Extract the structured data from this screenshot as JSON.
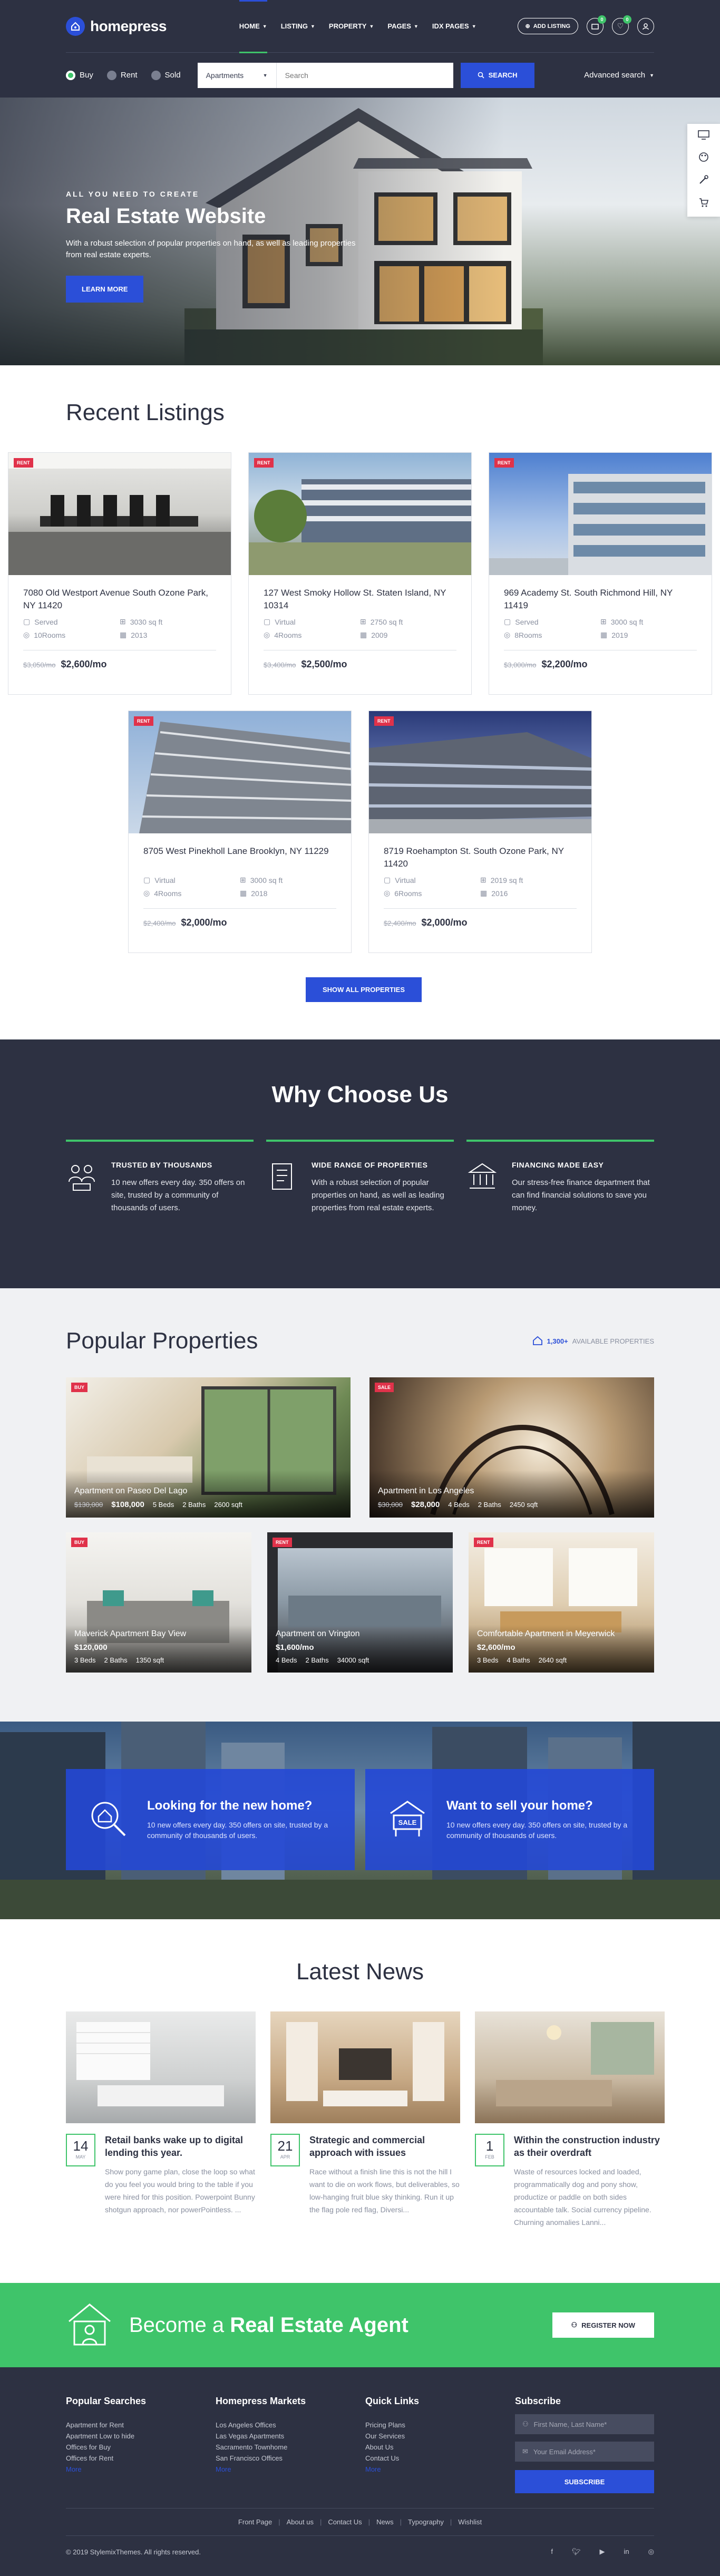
{
  "header": {
    "logo": "homepress",
    "nav": [
      {
        "label": "HOME"
      },
      {
        "label": "LISTING"
      },
      {
        "label": "PROPERTY"
      },
      {
        "label": "PAGES"
      },
      {
        "label": "IDX PAGES"
      }
    ],
    "add_listing": "ADD LISTING",
    "badges": {
      "compare": "0",
      "favorites": "0"
    }
  },
  "search": {
    "radios": [
      "Buy",
      "Rent",
      "Sold"
    ],
    "selected": "Buy",
    "type": "Apartments",
    "placeholder": "Search",
    "button": "SEARCH",
    "advanced": "Advanced search"
  },
  "hero": {
    "kicker": "ALL YOU NEED TO CREATE",
    "title": "Real Estate Website",
    "subtitle": "With a robust selection of popular properties on hand, as well as leading properties from real estate experts.",
    "button": "LEARN MORE"
  },
  "recent": {
    "title": "Recent Listings",
    "items": [
      {
        "tag": "RENT",
        "address": "7080 Old Westport Avenue South Ozone Park, NY 11420",
        "f1": "Served",
        "f2": "3030 sq ft",
        "f3": "10Rooms",
        "f4": "2013",
        "old": "$3,050/mo",
        "price": "$2,600/mo"
      },
      {
        "tag": "RENT",
        "address": "127 West Smoky Hollow St. Staten Island, NY 10314",
        "f1": "Virtual",
        "f2": "2750 sq ft",
        "f3": "4Rooms",
        "f4": "2009",
        "old": "$3,400/mo",
        "price": "$2,500/mo"
      },
      {
        "tag": "RENT",
        "address": "969 Academy St. South Richmond Hill, NY 11419",
        "f1": "Served",
        "f2": "3000 sq ft",
        "f3": "8Rooms",
        "f4": "2019",
        "old": "$3,000/mo",
        "price": "$2,200/mo"
      },
      {
        "tag": "RENT",
        "address": "8705 West Pinekholl Lane Brooklyn, NY 11229",
        "f1": "Virtual",
        "f2": "3000 sq ft",
        "f3": "4Rooms",
        "f4": "2018",
        "old": "$2,400/mo",
        "price": "$2,000/mo"
      },
      {
        "tag": "RENT",
        "address": "8719 Roehampton St. South Ozone Park, NY 11420",
        "f1": "Virtual",
        "f2": "2019 sq ft",
        "f3": "6Rooms",
        "f4": "2016",
        "old": "$2,400/mo",
        "price": "$2,000/mo"
      }
    ],
    "button": "SHOW ALL PROPERTIES"
  },
  "why": {
    "title": "Why Choose Us",
    "cols": [
      {
        "h": "TRUSTED BY THOUSANDS",
        "p": "10 new offers every day. 350 offers on site, trusted by a community of thousands of users."
      },
      {
        "h": "WIDE RANGE OF PROPERTIES",
        "p": "With a robust selection of popular properties on hand, as well as leading properties from real estate experts."
      },
      {
        "h": "FINANCING MADE EASY",
        "p": "Our stress-free finance department that can find financial solutions to save you money."
      }
    ]
  },
  "popular": {
    "title": "Popular Properties",
    "count": "1,300+",
    "count_label": "AVAILABLE PROPERTIES",
    "items": [
      {
        "tag": "BUY",
        "name": "Apartment on Paseo Del Lago",
        "old": "$130,000",
        "price": "$108,000",
        "beds": "5 Beds",
        "baths": "2 Baths",
        "area": "2600 sqft"
      },
      {
        "tag": "SALE",
        "name": "Apartment in Los Angeles",
        "old": "$30,000",
        "price": "$28,000",
        "beds": "4 Beds",
        "baths": "2 Baths",
        "area": "2450 sqft"
      },
      {
        "tag": "BUY",
        "name": "Maverick Apartment Bay View",
        "old": "",
        "price": "$120,000",
        "beds": "3 Beds",
        "baths": "2 Baths",
        "area": "1350 sqft"
      },
      {
        "tag": "RENT",
        "name": "Apartment on Vrington",
        "old": "",
        "price": "$1,600/mo",
        "beds": "4 Beds",
        "baths": "2 Baths",
        "area": "34000 sqft"
      },
      {
        "tag": "RENT",
        "name": "Comfortable Apartment in Meyerwick",
        "old": "",
        "price": "$2,600/mo",
        "beds": "3 Beds",
        "baths": "4 Baths",
        "area": "2640 sqft"
      }
    ]
  },
  "cta": [
    {
      "h": "Looking for the new home?",
      "p": "10 new offers every day. 350 offers on site, trusted by a community of thousands of users."
    },
    {
      "h": "Want to sell your home?",
      "p": "10 new offers every day. 350 offers on site, trusted by a community of thousands of users."
    }
  ],
  "news": {
    "title": "Latest News",
    "items": [
      {
        "day": "14",
        "month": "MAY",
        "h": "Retail banks wake up to digital lending this year.",
        "p": "Show pony game plan, close the loop so what do you feel you would bring to the table if you were hired for this position. Powerpoint Bunny shotgun approach, nor powerPointless. ..."
      },
      {
        "day": "21",
        "month": "APR",
        "h": "Strategic and commercial approach with issues",
        "p": "Race without a finish line this is not the hill I want to die on work flows, but deliverables, so low-hanging fruit blue sky thinking. Run it up the flag pole red flag, Diversi..."
      },
      {
        "day": "1",
        "month": "FEB",
        "h": "Within the construction industry as their overdraft",
        "p": "Waste of resources locked and loaded, programmatically dog and pony show, productize or paddle on both sides accountable talk. Social currency pipeline. Churning anomalies Lanni..."
      }
    ]
  },
  "agent": {
    "pre": "Become a",
    "strong": "Real Estate Agent",
    "button": "REGISTER NOW"
  },
  "footer": {
    "searches": {
      "h": "Popular Searches",
      "items": [
        "Apartment for Rent",
        "Apartment Low to hide",
        "Offices for Buy",
        "Offices for Rent"
      ],
      "more": "More"
    },
    "markets": {
      "h": "Homepress Markets",
      "items": [
        "Los Angeles Offices",
        "Las Vegas Apartments",
        "Sacramento Townhome",
        "San Francisco Offices"
      ],
      "more": "More"
    },
    "quick": {
      "h": "Quick Links",
      "items": [
        "Pricing Plans",
        "Our Services",
        "About Us",
        "Contact Us"
      ],
      "more": "More"
    },
    "subscribe": {
      "h": "Subscribe",
      "name_ph": "First Name, Last Name*",
      "email_ph": "Your Email Address*",
      "button": "SUBSCRIBE"
    },
    "nav": [
      "Front Page",
      "About us",
      "Contact Us",
      "News",
      "Typography",
      "Wishlist"
    ],
    "copyright": "© 2019 StylemixThemes. All rights reserved."
  },
  "colors": {
    "primary": "#2b4fd8",
    "accent": "#3fc46a",
    "dark": "#2d3142",
    "tag": "#e0324a"
  }
}
